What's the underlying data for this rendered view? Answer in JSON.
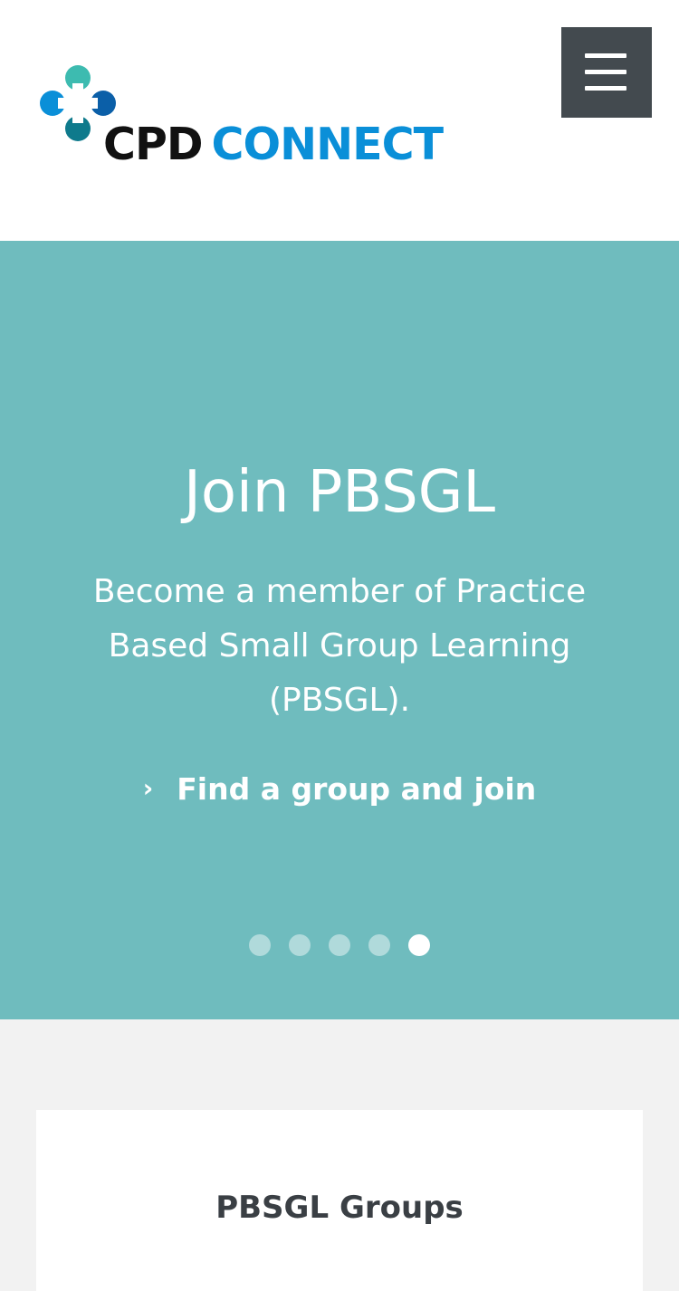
{
  "header": {
    "logo": {
      "word1": "CPD",
      "word2": "CONNECT",
      "colors": {
        "cpd": "#111111",
        "connect": "#0a8fd8",
        "mark_top": "#3dbbb0",
        "mark_left": "#0a8fd8",
        "mark_right": "#0b5fa8",
        "mark_bottom": "#0e7a8c"
      }
    },
    "menu_icon": "hamburger-icon"
  },
  "hero": {
    "title": "Join PBSGL",
    "description": "Become a member of Practice Based Small Group Learning (PBSGL).",
    "link_icon": "chevron-right-icon",
    "link_label": "Find a group and join",
    "background_color": "#6fbcbe",
    "carousel": {
      "slide_count": 5,
      "active_index": 5
    }
  },
  "section": {
    "card_title": "PBSGL Groups"
  }
}
